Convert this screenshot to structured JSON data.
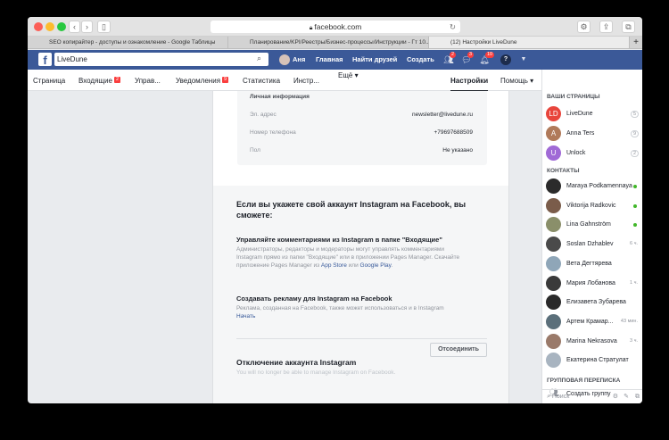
{
  "browser": {
    "url": "facebook.com",
    "tabs": [
      "SEO копирайтер - доступы и ознакомление - Google Таблицы",
      "Планирование/KPI/Реестры/Бизнес-процессы/Инструкции - Гт 10...",
      "(12) Настройки LiveDune"
    ],
    "new_tab_label": "+"
  },
  "header": {
    "logo": "f",
    "search_value": "LiveDune",
    "user": "Аня",
    "links": [
      "Главная",
      "Найти друзей",
      "Создать"
    ],
    "badges": {
      "friends": "2",
      "messages": "3",
      "notifications": "10"
    },
    "help": "?"
  },
  "tabs": {
    "items": [
      "Страница",
      "Входящие",
      "Управ...",
      "Уведомления",
      "Статистика",
      "Инстр...",
      "Ещё ▾",
      "Настройки",
      "Помощь ▾"
    ],
    "inbox_badge": "2",
    "notif_badge": "9"
  },
  "info": {
    "title": "Личная информация",
    "rows": [
      {
        "label": "Эл. адрес",
        "value": "newsletter@livedune.ru"
      },
      {
        "label": "Номер телефона",
        "value": "+79697688509"
      },
      {
        "label": "Пол",
        "value": "Не указано"
      }
    ]
  },
  "instagram": {
    "title": "Если вы укажете свой аккаунт Instagram на Facebook, вы сможете:",
    "s1_title": "Управляйте комментариями из Instagram в папке \"Входящие\"",
    "s1_desc": "Администраторы, редакторы и модераторы могут управлять комментариями Instagram прямо из папки \"Входящие\" или в приложении Pages Manager. Скачайте приложение Pages Manager из",
    "s1_link1": "App Store",
    "s1_or": "или",
    "s1_link2": "Google Play",
    "s2_title": "Создавать рекламу для Instagram на Facebook",
    "s2_desc": "Реклама, созданная на Facebook, также может использоваться и в Instagram",
    "s2_link": "Начать",
    "disc_title": "Отключение аккаунта Instagram",
    "disc_desc": "You will no longer be able to manage Instagram on Facebook.",
    "disc_button": "Отсоединить"
  },
  "sidebar": {
    "pages_title": "ВАШИ СТРАНИЦЫ",
    "pages": [
      {
        "name": "LiveDune",
        "count": "5",
        "color": "#e8453c",
        "initial": "LD"
      },
      {
        "name": "Anna Ters",
        "count": "9",
        "color": "#b07a5a",
        "initial": "A"
      },
      {
        "name": "Unlock",
        "count": "2",
        "color": "#a06ad6",
        "initial": "U"
      }
    ],
    "contacts_title": "КОНТАКТЫ",
    "contacts": [
      {
        "name": "Maraya Podkamennaya",
        "status": "",
        "color": "#2b2b2b"
      },
      {
        "name": "Viktorija Radkovic",
        "status": "",
        "color": "#7a5c4a"
      },
      {
        "name": "Lina Gahnström",
        "status": "",
        "color": "#8a8f6a"
      },
      {
        "name": "Soslan Dzhablev",
        "status": "6 ч.",
        "color": "#4a4a4a"
      },
      {
        "name": "Вета Дегтярева",
        "status": "",
        "color": "#8fa6b8"
      },
      {
        "name": "Мария Лобанова",
        "status": "1 ч.",
        "color": "#3a3a3a"
      },
      {
        "name": "Елизавета Зубарева",
        "status": "",
        "color": "#2a2a2a"
      },
      {
        "name": "Артем Крамар...",
        "status": "43 мин.",
        "color": "#5b6f7a"
      },
      {
        "name": "Marina Nekrasova",
        "status": "3 ч.",
        "color": "#9a7a6a"
      },
      {
        "name": "Екатерина Стратулат",
        "status": "",
        "color": "#a8b4c0"
      }
    ],
    "group_title": "ГРУППОВАЯ ПЕРЕПИСКА",
    "create_group": "Создать группу",
    "search_placeholder": "Поиск"
  }
}
